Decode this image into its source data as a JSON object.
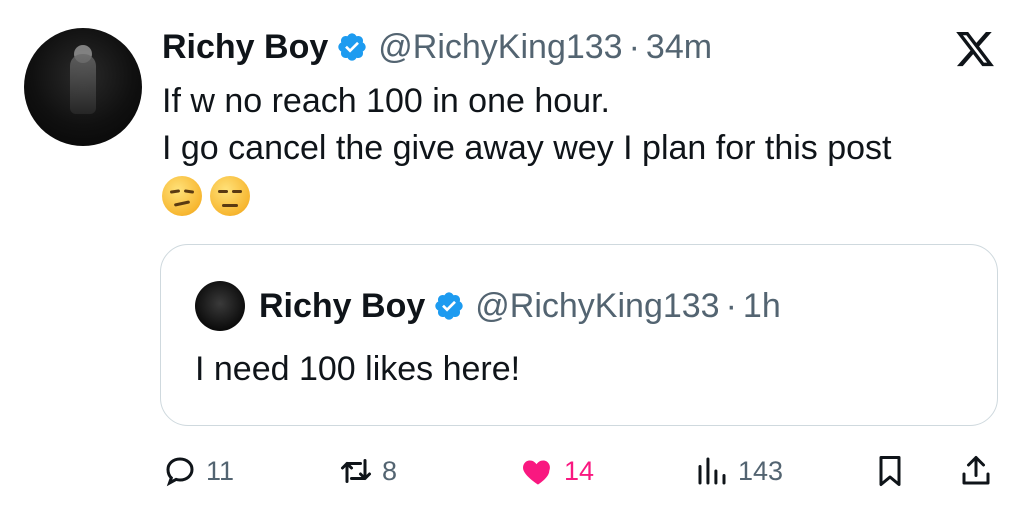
{
  "post": {
    "author_name": "Richy Boy",
    "handle": "@RichyKing133",
    "separator": "·",
    "time": "34m",
    "text_lines": [
      "If w no reach 100 in one hour.",
      "I go cancel the give away wey I plan for this post"
    ],
    "emojis": [
      "smirking-face",
      "unamused-face"
    ]
  },
  "quoted_post": {
    "author_name": "Richy Boy",
    "handle": "@RichyKing133",
    "separator": "·",
    "time": "1h",
    "text": "I need 100 likes here!"
  },
  "actions": {
    "replies": "11",
    "reposts": "8",
    "likes": "14",
    "views": "143"
  },
  "colors": {
    "verified": "#1d9bf0",
    "like": "#f91880",
    "muted": "#536471",
    "border": "#cfd9de"
  }
}
